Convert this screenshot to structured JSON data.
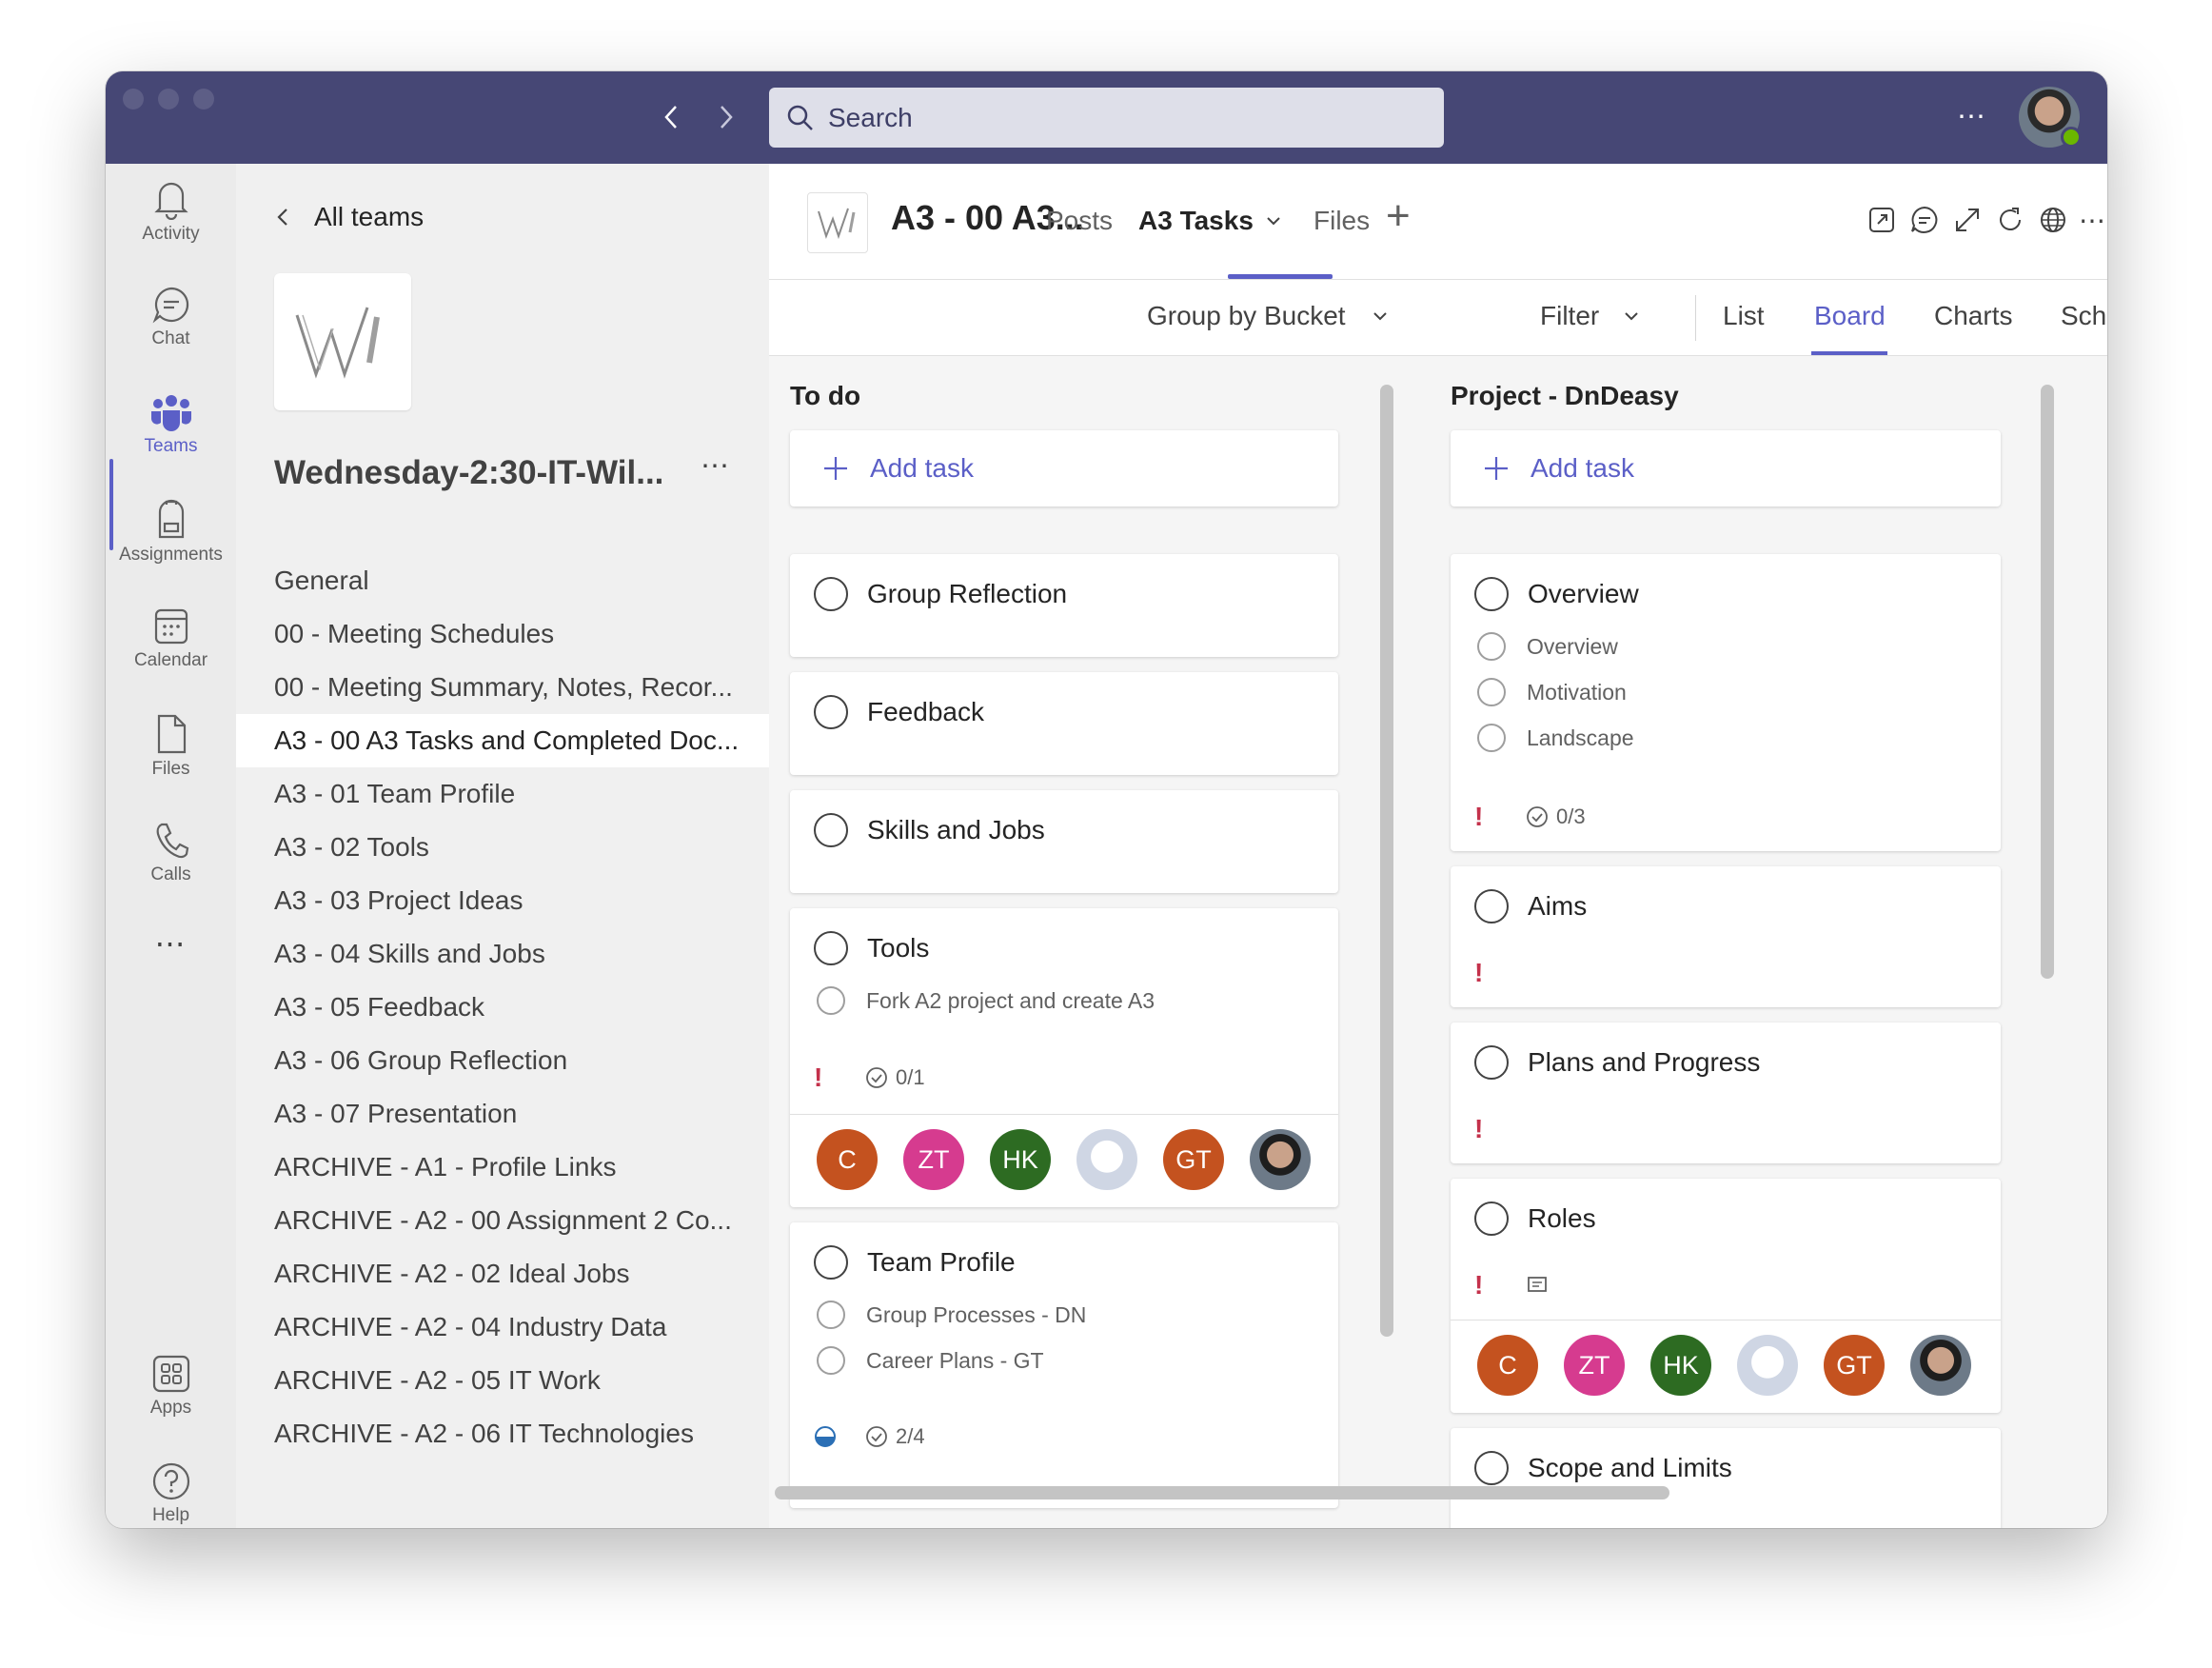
{
  "app": {
    "search_placeholder": "Search",
    "more": "⋯"
  },
  "rail": {
    "items": [
      {
        "label": "Activity",
        "icon": "bell-icon"
      },
      {
        "label": "Chat",
        "icon": "chat-icon"
      },
      {
        "label": "Teams",
        "icon": "teams-icon"
      },
      {
        "label": "Assignments",
        "icon": "backpack-icon"
      },
      {
        "label": "Calendar",
        "icon": "calendar-icon"
      },
      {
        "label": "Files",
        "icon": "file-icon"
      },
      {
        "label": "Calls",
        "icon": "phone-icon"
      }
    ],
    "more": "⋯",
    "apps_label": "Apps",
    "help_label": "Help"
  },
  "team": {
    "back_label": "All teams",
    "name": "Wednesday-2:30-IT-Wil...",
    "more": "⋯",
    "channels": [
      "General",
      "00 - Meeting Schedules",
      "00 - Meeting Summary, Notes, Recor...",
      "A3 - 00 A3 Tasks and Completed Doc...",
      "A3 - 01 Team Profile",
      "A3 - 02 Tools",
      "A3 - 03 Project Ideas",
      "A3 - 04 Skills and Jobs",
      "A3 - 05 Feedback",
      "A3 - 06 Group Reflection",
      "A3 - 07 Presentation",
      "ARCHIVE - A1 - Profile Links",
      "ARCHIVE - A2 - 00 Assignment 2 Co...",
      "ARCHIVE - A2 - 02 Ideal Jobs",
      "ARCHIVE - A2 - 04 Industry Data",
      "ARCHIVE - A2 - 05 IT Work",
      "ARCHIVE - A2 - 06 IT Technologies"
    ],
    "selected_index": 3
  },
  "header": {
    "title": "A3 - 00 A3...",
    "tabs": [
      "Posts",
      "A3 Tasks",
      "Files"
    ],
    "add": "+"
  },
  "toolbar": {
    "group_by": "Group by Bucket",
    "filter": "Filter",
    "views": [
      "List",
      "Board",
      "Charts",
      "Schedule"
    ],
    "active_view": "Board"
  },
  "board": {
    "add_task": "Add task",
    "buckets": [
      {
        "title": "To do",
        "tasks": [
          {
            "title": "Group Reflection"
          },
          {
            "title": "Feedback"
          },
          {
            "title": "Skills and Jobs"
          },
          {
            "title": "Tools",
            "subtasks": [
              "Fork A2 project and create A3"
            ],
            "priority": "!",
            "checklist": "0/1"
          },
          {
            "title": "Team Profile",
            "subtasks": [
              "Group Processes - DN",
              "Career Plans - GT"
            ],
            "checklist": "2/4"
          }
        ]
      },
      {
        "title": "Project - DnDeasy",
        "tasks": [
          {
            "title": "Overview",
            "subtasks": [
              "Overview",
              "Motivation",
              "Landscape"
            ],
            "priority": "!",
            "checklist": "0/3"
          },
          {
            "title": "Aims",
            "priority": "!"
          },
          {
            "title": "Plans and Progress",
            "priority": "!"
          },
          {
            "title": "Roles",
            "priority": "!"
          },
          {
            "title": "Scope and Limits"
          }
        ]
      }
    ],
    "assignees": [
      {
        "initials": "C",
        "color": "#c4521f"
      },
      {
        "initials": "ZT",
        "color": "#d63b8f"
      },
      {
        "initials": "HK",
        "color": "#2d6b22"
      },
      {
        "initials": "",
        "color": "#dfe3ec"
      },
      {
        "initials": "GT",
        "color": "#c4521f"
      },
      {
        "initials": "",
        "color": "#3a3a3a"
      }
    ]
  }
}
